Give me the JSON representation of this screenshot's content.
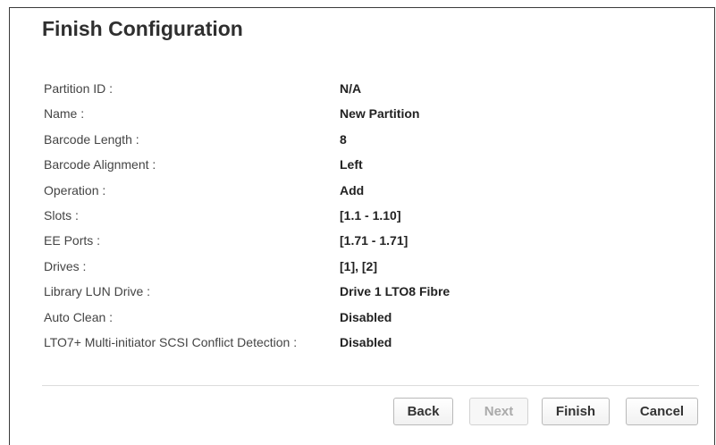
{
  "page": {
    "title": "Finish Configuration"
  },
  "summary": [
    {
      "label": "Partition ID :",
      "value": "N/A"
    },
    {
      "label": "Name :",
      "value": "New Partition"
    },
    {
      "label": "Barcode Length :",
      "value": "8"
    },
    {
      "label": "Barcode Alignment :",
      "value": "Left"
    },
    {
      "label": "Operation :",
      "value": "Add"
    },
    {
      "label": "Slots :",
      "value": "[1.1 - 1.10]"
    },
    {
      "label": "EE Ports :",
      "value": "[1.71 - 1.71]"
    },
    {
      "label": "Drives :",
      "value": "[1], [2]"
    },
    {
      "label": "Library LUN Drive :",
      "value": "Drive 1 LTO8 Fibre"
    },
    {
      "label": "Auto Clean :",
      "value": "Disabled"
    },
    {
      "label": "LTO7+ Multi-initiator SCSI Conflict Detection :",
      "value": "Disabled"
    }
  ],
  "buttons": {
    "back": "Back",
    "next": "Next",
    "finish": "Finish",
    "cancel": "Cancel"
  },
  "state": {
    "next_disabled": true
  }
}
